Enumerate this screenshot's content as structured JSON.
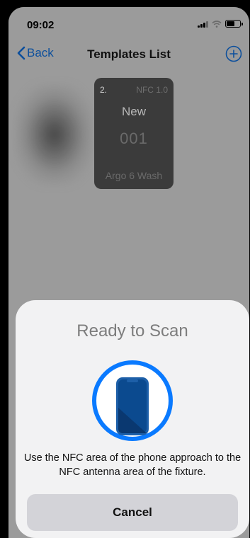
{
  "status_bar": {
    "time": "09:02",
    "icons": [
      "signal-icon",
      "wifi-icon",
      "battery-icon"
    ]
  },
  "nav": {
    "back_label": "Back",
    "title": "Templates List",
    "add_icon": "plus-circle-icon"
  },
  "template_card": {
    "index": "2.",
    "type": "NFC 1.0",
    "status": "New",
    "number": "001",
    "name": "Argo 6 Wash"
  },
  "scan_sheet": {
    "title": "Ready to Scan",
    "icon": "nfc-phone-scan-icon",
    "message": "Use the NFC area of the phone approach to the NFC antenna area of the fixture.",
    "cancel_label": "Cancel"
  },
  "colors": {
    "accent": "#0a7aff",
    "nav_link": "#0c4f9c",
    "dimmed_background": "#9b9b9b",
    "sheet_background": "#f2f2f3",
    "button_background": "#d3d3d8"
  }
}
